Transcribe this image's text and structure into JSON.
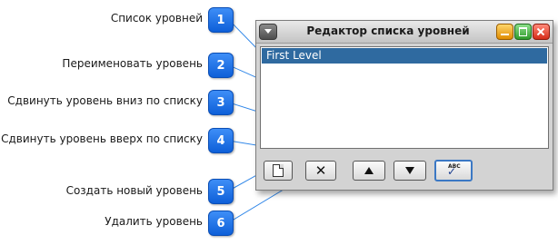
{
  "callouts": [
    {
      "num": "1",
      "label": "Список уровней"
    },
    {
      "num": "2",
      "label": "Переименовать уровень"
    },
    {
      "num": "3",
      "label": "Сдвинуть уровень вниз по списку"
    },
    {
      "num": "4",
      "label": "Сдвинуть уровень вверх по списку"
    },
    {
      "num": "5",
      "label": "Создать новый уровень"
    },
    {
      "num": "6",
      "label": "Удалить уровень"
    }
  ],
  "window": {
    "title": "Редактор списка уровней",
    "list_items": [
      "First Level"
    ]
  },
  "toolbar": {
    "buttons": [
      {
        "icon": "new-document-icon"
      },
      {
        "icon": "delete-x-icon"
      },
      {
        "icon": "arrow-up-icon"
      },
      {
        "icon": "arrow-down-icon"
      },
      {
        "icon": "rename-abc-check-icon"
      }
    ]
  },
  "colors": {
    "badge": "#1f6fe6",
    "callout_line": "#2f86e8",
    "selection": "#2f6aa0"
  }
}
